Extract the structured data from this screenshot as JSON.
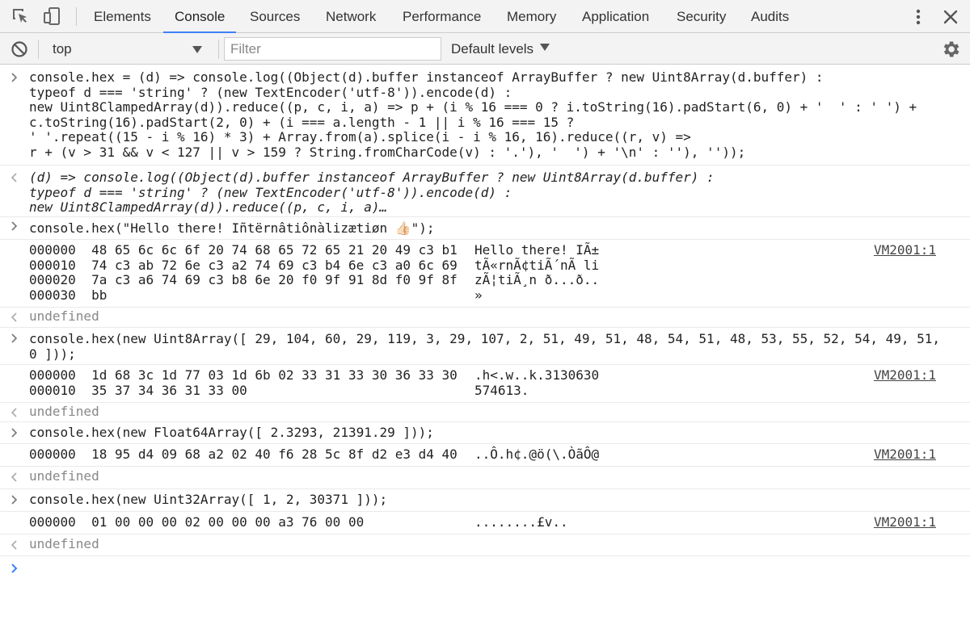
{
  "tabs": [
    {
      "label": "Elements",
      "active": false
    },
    {
      "label": "Console",
      "active": true
    },
    {
      "label": "Sources",
      "active": false
    },
    {
      "label": "Network",
      "active": false
    },
    {
      "label": "Performance",
      "active": false
    },
    {
      "label": "Memory",
      "active": false
    },
    {
      "label": "Application",
      "active": false
    },
    {
      "label": "Security",
      "active": false
    },
    {
      "label": "Audits",
      "active": false
    }
  ],
  "toolbar": {
    "context": "top",
    "filter_placeholder": "Filter",
    "levels": "Default levels"
  },
  "colors": {
    "accent": "#3e82f7",
    "keyword": "#aa0d91",
    "string": "#c41a16",
    "number": "#1c00cf"
  },
  "icons": [
    "inspect-element-icon",
    "device-toolbar-icon",
    "more-vert-icon",
    "close-icon",
    "clear-console-icon",
    "gear-icon",
    "input-prompt-icon",
    "result-arrow-icon"
  ],
  "console": {
    "entry1_input": [
      "console.hex = (d) => console.log((Object(d).buffer instanceof ArrayBuffer ? new Uint8Array(d.buffer) :",
      "typeof d === 'string' ? (new TextEncoder('utf-8')).encode(d) :",
      "new Uint8ClampedArray(d)).reduce((p, c, i, a) => p + (i % 16 === 0 ? i.toString(16).padStart(6, 0) + '  ' : ' ') +",
      "c.toString(16).padStart(2, 0) + (i === a.length - 1 || i % 16 === 15 ?",
      "' '.repeat((15 - i % 16) * 3) + Array.from(a).splice(i - i % 16, 16).reduce((r, v) =>",
      "r + (v > 31 && v < 127 || v > 159 ? String.fromCharCode(v) : '.'), '  ') + '\\n' : ''), ''));"
    ],
    "entry1_result": [
      "(d) => console.log((Object(d).buffer instanceof ArrayBuffer ? new Uint8Array(d.buffer) :",
      "typeof d === 'string' ? (new TextEncoder('utf-8')).encode(d) :",
      "new Uint8ClampedArray(d)).reduce((p, c, i, a)…"
    ],
    "entry2_input": "console.hex(\"Hello there! Iñtërnâtiônàlizætiøn 👍🏻\");",
    "entry2_hex": [
      "000000  48 65 6c 6c 6f 20 74 68 65 72 65 21 20 49 c3 b1",
      "000010  74 c3 ab 72 6e c3 a2 74 69 c3 b4 6e c3 a0 6c 69",
      "000020  7a c3 a6 74 69 c3 b8 6e 20 f0 9f 91 8d f0 9f 8f",
      "000030  bb"
    ],
    "entry2_ascii": [
      "Hello there! IÃ±",
      "tÃ«rnÃ¢tiÃ´nÃ li",
      "zÃ¦tiÃ¸n ð...ð..",
      "»"
    ],
    "entry3_input": [
      "console.hex(new Uint8Array([ 29, 104, 60, 29, 119, 3, 29, 107, 2, 51, 49, 51, 48, 54, 51, 48, 53, 55, 52, 54, 49, 51,",
      "0 ]));"
    ],
    "entry3_hex": [
      "000000  1d 68 3c 1d 77 03 1d 6b 02 33 31 33 30 36 33 30",
      "000010  35 37 34 36 31 33 00"
    ],
    "entry3_ascii": [
      ".h<.w..k.3130630",
      "574613."
    ],
    "entry4_input": "console.hex(new Float64Array([ 2.3293, 21391.29 ]));",
    "entry4_hex": "000000  18 95 d4 09 68 a2 02 40 f6 28 5c 8f d2 e3 d4 40",
    "entry4_ascii": "..Ô.h¢.@ö(\\.ÒãÔ@",
    "entry5_input": "console.hex(new Uint32Array([ 1, 2, 30371 ]));",
    "entry5_hex": "000000  01 00 00 00 02 00 00 00 a3 76 00 00",
    "entry5_ascii": "........£v..",
    "source_link": "VM2001:1",
    "undefined_text": "undefined"
  }
}
